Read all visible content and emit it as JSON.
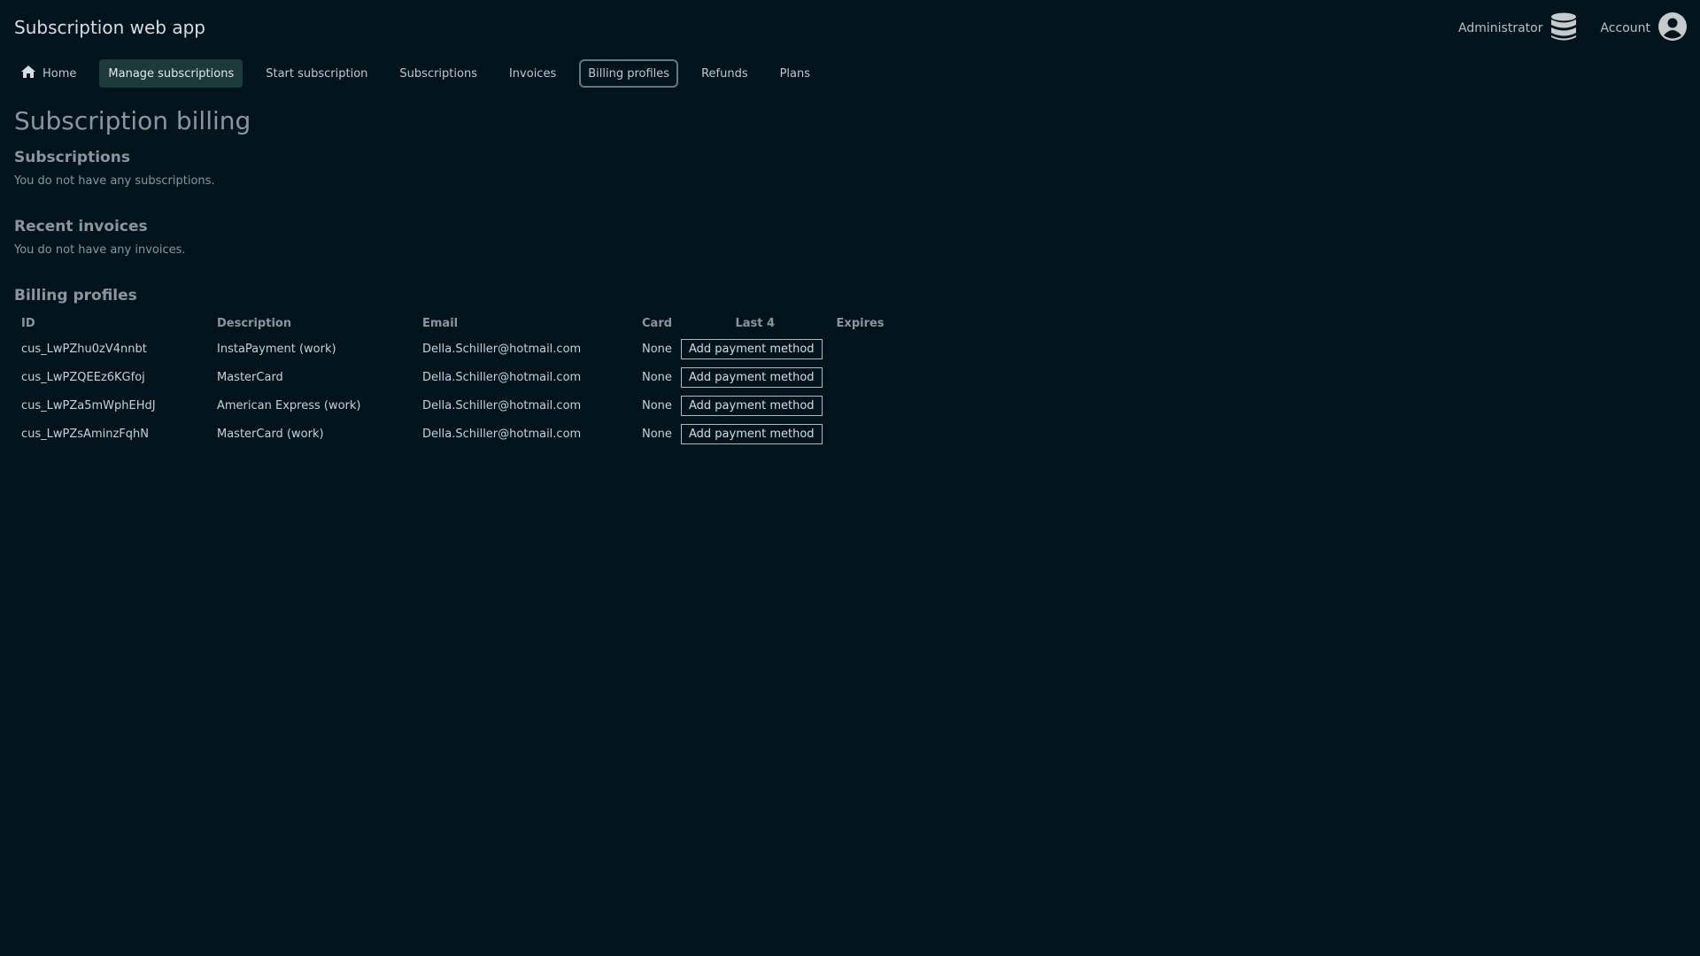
{
  "header": {
    "app_title": "Subscription web app",
    "admin_label": "Administrator",
    "account_label": "Account"
  },
  "nav": {
    "home": "Home",
    "manage": "Manage subscriptions",
    "start": "Start subscription",
    "subscriptions": "Subscriptions",
    "invoices": "Invoices",
    "billing_profiles": "Billing profiles",
    "refunds": "Refunds",
    "plans": "Plans"
  },
  "page": {
    "title": "Subscription billing",
    "subscriptions_heading": "Subscriptions",
    "subscriptions_empty": "You do not have any subscriptions.",
    "invoices_heading": "Recent invoices",
    "invoices_empty": "You do not have any invoices.",
    "billing_heading": "Billing profiles"
  },
  "billing_table": {
    "columns": [
      "ID",
      "Description",
      "Email",
      "Card",
      "Last 4",
      "Expires"
    ],
    "rows": [
      {
        "id": "cus_LwPZhu0zV4nnbt",
        "description": "InstaPayment (work)",
        "email": "Della.Schiller@hotmail.com",
        "card": "None",
        "action": "Add payment method"
      },
      {
        "id": "cus_LwPZQEEz6KGfoj",
        "description": "MasterCard",
        "email": "Della.Schiller@hotmail.com",
        "card": "None",
        "action": "Add payment method"
      },
      {
        "id": "cus_LwPZa5mWphEHdJ",
        "description": "American Express (work)",
        "email": "Della.Schiller@hotmail.com",
        "card": "None",
        "action": "Add payment method"
      },
      {
        "id": "cus_LwPZsAminzFqhN",
        "description": "MasterCard (work)",
        "email": "Della.Schiller@hotmail.com",
        "card": "None",
        "action": "Add payment method"
      }
    ]
  },
  "colors": {
    "background": "#02141b",
    "active_nav": "#1d3a3a",
    "muted_text": "#8c969a"
  },
  "icons": {
    "home": "home-icon",
    "admin": "database-icon",
    "account": "user-circle-icon"
  }
}
